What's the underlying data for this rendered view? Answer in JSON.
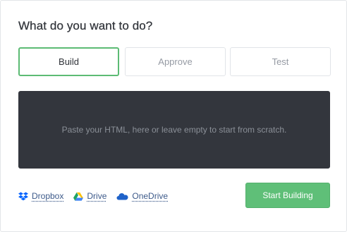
{
  "heading": "What do you want to do?",
  "tabs": [
    {
      "label": "Build",
      "active": true
    },
    {
      "label": "Approve",
      "active": false
    },
    {
      "label": "Test",
      "active": false
    }
  ],
  "editor": {
    "placeholder": "Paste your HTML, here or leave empty to start from scratch."
  },
  "sources": [
    {
      "label": "Dropbox",
      "icon": "dropbox-icon",
      "color": "#0061fe"
    },
    {
      "label": "Drive",
      "icon": "google-drive-icon"
    },
    {
      "label": "OneDrive",
      "icon": "onedrive-icon",
      "color": "#1f62c9"
    }
  ],
  "start_button": {
    "label": "Start Building"
  },
  "colors": {
    "accent_green": "#5fbf78",
    "active_tab_border": "#5cbb74",
    "editor_background": "#33363d",
    "link_text": "#3d5a8a"
  }
}
